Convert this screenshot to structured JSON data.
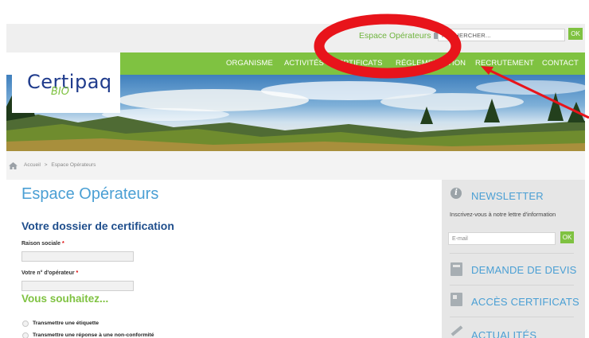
{
  "header": {
    "operators_link": "Espace Opérateurs",
    "search_placeholder": "RECHERCHER...",
    "search_button": "OK"
  },
  "logo": {
    "name": "Certipaq",
    "sub": "BIO"
  },
  "nav": {
    "items": [
      "ORGANISME",
      "ACTIVITÉS",
      "CERTIFICATS",
      "RÉGLEMENTATION",
      "RECRUTEMENT",
      "CONTACT"
    ]
  },
  "breadcrumb": {
    "home": "Accueil",
    "separator": ">",
    "current": "Espace Opérateurs"
  },
  "main": {
    "title": "Espace Opérateurs",
    "subtitle": "Votre dossier de certification",
    "fields": [
      {
        "label": "Raison sociale",
        "required": "*",
        "value": ""
      },
      {
        "label": "Votre n° d'opérateur",
        "required": "*",
        "value": ""
      }
    ],
    "wish_heading": "Vous souhaitez...",
    "options": [
      "Transmettre une étiquette",
      "Transmettre une réponse à une non-conformité"
    ]
  },
  "sidebar": {
    "newsletter_title": "NEWSLETTER",
    "newsletter_text": "Inscrivez-vous à notre lettre d'information",
    "email_placeholder": "E-mail",
    "email_button": "OK",
    "devis": "DEMANDE DE DEVIS",
    "certificats": "ACCÈS CERTIFICATS",
    "actualites": "ACTUALITÉS"
  },
  "colors": {
    "brand_green": "#7fc241",
    "title_blue": "#4a9fd4",
    "logo_navy": "#1f3b8c",
    "annotation_red": "#e8141b"
  },
  "icons": [
    "briefcase-icon",
    "home-icon",
    "info-icon",
    "calculator-icon",
    "document-icon",
    "pencil-icon"
  ]
}
